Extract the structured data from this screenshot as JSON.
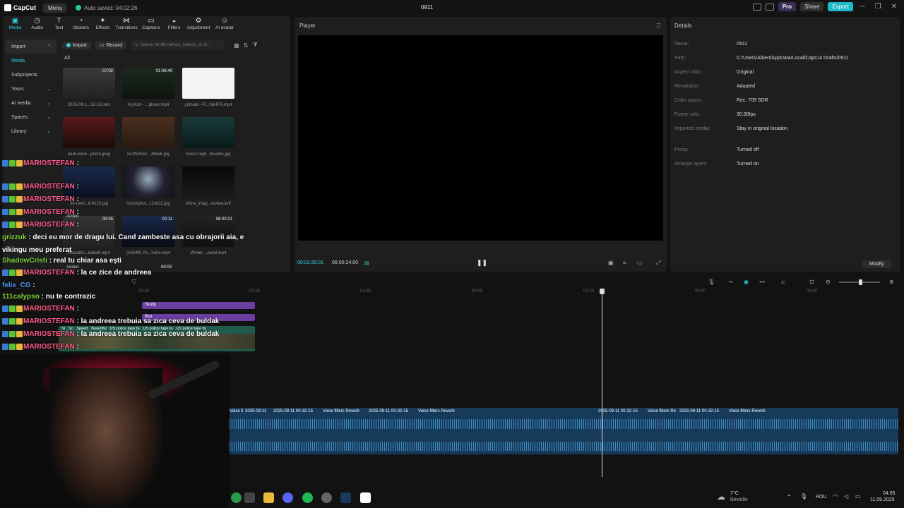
{
  "app": {
    "brand": "CapCut",
    "menu": "Menu",
    "autosave": "Auto saved: 04:02:26",
    "title": "0911",
    "pro": "Pro",
    "share": "Share",
    "export": "Export"
  },
  "tabs": [
    {
      "label": "Media",
      "icon": "media-icon"
    },
    {
      "label": "Audio",
      "icon": "audio-icon"
    },
    {
      "label": "Text",
      "icon": "text-icon"
    },
    {
      "label": "Stickers",
      "icon": "sticker-icon"
    },
    {
      "label": "Effects",
      "icon": "effects-icon"
    },
    {
      "label": "Transitions",
      "icon": "transitions-icon"
    },
    {
      "label": "Captions",
      "icon": "captions-icon"
    },
    {
      "label": "Filters",
      "icon": "filters-icon"
    },
    {
      "label": "Adjustment",
      "icon": "adjust-icon"
    },
    {
      "label": "AI avatar",
      "icon": "avatar-icon"
    }
  ],
  "sidebar": {
    "import": "Import",
    "media": "Media",
    "subprojects": "Subprojects",
    "yours": "Yours",
    "ai_media": "AI media",
    "spaces": "Spaces",
    "library": "Library"
  },
  "media": {
    "import_btn": "Import",
    "record_btn": "Record",
    "search_placeholder": "Search for file names, scenes, or di...",
    "all": "All",
    "items": [
      {
        "label": "2025-09-1...32-15.mkv",
        "duration": "07:02"
      },
      {
        "label": "Asylum - ...phere.mp4",
        "duration": "01:06:40"
      },
      {
        "label": "y2mate---R...0pHFR.mp4",
        "duration": ""
      },
      {
        "label": "dark-eerie...photo.jpeg",
        "duration": ""
      },
      {
        "label": "bc1f52be2...2b9e6.jpg",
        "duration": ""
      },
      {
        "label": "forest-nigh...houette.jpg",
        "duration": ""
      },
      {
        "label": "3d-rend...8-9123.jpg",
        "duration": ""
      },
      {
        "label": "istockphot...12x612.jpg",
        "duration": ""
      },
      {
        "label": "inline_imag...review.avif",
        "duration": ""
      },
      {
        "label": "Beautiful...ladesh.mp4",
        "duration": "00:35"
      },
      {
        "label": "(ASMR) Pe...horts.mp4",
        "duration": "00:11"
      },
      {
        "label": "Winter ...ound.mp4",
        "duration": "06:00:21"
      }
    ],
    "added": "Added",
    "extra_duration": "00:03"
  },
  "player": {
    "title": "Player",
    "current": "00:02:35:01",
    "total": "06:00:24:00"
  },
  "details": {
    "title": "Details",
    "rows": [
      {
        "k": "Name:",
        "v": "0911"
      },
      {
        "k": "Path:",
        "v": "C:/Users/Albert/AppData/Local/CapCut Drafts/0911"
      },
      {
        "k": "Aspect ratio:",
        "v": "Original"
      },
      {
        "k": "Resolution:",
        "v": "Adapted"
      },
      {
        "k": "Color space:",
        "v": "Rec. 709 SDR"
      },
      {
        "k": "Frame rate:",
        "v": "30.00fps"
      },
      {
        "k": "Imported media:",
        "v": "Stay in original location"
      },
      {
        "k": "Proxy:",
        "v": "Turned off"
      },
      {
        "k": "Arrange layers",
        "v": "Turned on"
      }
    ],
    "modify": "Modify"
  },
  "timeline": {
    "ruler": [
      "00:30",
      "01:00",
      "01:30",
      "02:00",
      "02:30",
      "03:00",
      "03:30"
    ],
    "tracks": {
      "sticker1": "Skully",
      "sticker2": "Blur",
      "video_labels": [
        "Sl",
        "Sc",
        "Speed",
        "Beautiful",
        "US police tape fa",
        "US police tape fa",
        "US police tape fa"
      ]
    },
    "audio_labels": [
      "Voice fi",
      "2025-09-11",
      "2025-09-11 00-32-15",
      "Voice filters Reverb",
      "2025-09-11 00-32-15",
      "Voice filters Reverb",
      "2025-09-11 00-32-15",
      "Voice filters Re",
      "2025-09-11 00-32-15",
      "Voice filters Reverb"
    ]
  },
  "chat": [
    {
      "user": "MARIOSTEFAN",
      "msg": ":"
    },
    {
      "user": "MARIOSTEFAN",
      "msg": ":"
    },
    {
      "user": "MARIOSTEFAN",
      "msg": ":"
    },
    {
      "user": "MARIOSTEFAN",
      "msg": ":"
    },
    {
      "user": "MARIOSTEFAN",
      "msg": ":"
    },
    {
      "user": "grizzuk",
      "msg": ": deci eu mor de dragu lui. Cand zambeste asa cu obrajorii aia, e"
    },
    {
      "user": "",
      "msg": "vikingu meu preferat"
    },
    {
      "user": "ShadowCristi",
      "msg": ": real tu chiar asa ești"
    },
    {
      "user": "MARIOSTEFAN",
      "msg": ": la ce zice de andreea"
    },
    {
      "user": "felix_CG",
      "msg": ":"
    },
    {
      "user": "111calypso",
      "msg": ": nu te contrazic"
    },
    {
      "user": "MARIOSTEFAN",
      "msg": ":"
    },
    {
      "user": "MARIOSTEFAN",
      "msg": ": la andreea trebuia sa zica ceva de buldak"
    },
    {
      "user": "MARIOSTEFAN",
      "msg": ": la andreea trebuia sa zica ceva de buldak"
    },
    {
      "user": "MARIOSTEFAN",
      "msg": ":"
    }
  ],
  "taskbar": {
    "temp": "7°C",
    "weather": "Bewölkt",
    "lang": "ROU",
    "time": "04:05",
    "date": "11.09.2025"
  }
}
